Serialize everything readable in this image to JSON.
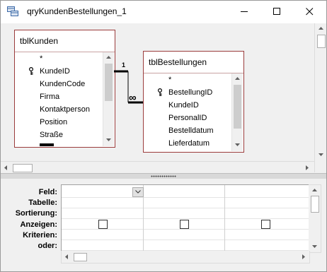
{
  "window": {
    "title": "qryKundenBestellungen_1",
    "icon": "query-icon",
    "controls": [
      "minimize-icon",
      "maximize-icon",
      "close-icon"
    ]
  },
  "tables": [
    {
      "name": "tblKunden",
      "fields": [
        "*",
        "KundeID",
        "KundenCode",
        "Firma",
        "Kontaktperson",
        "Position",
        "Straße"
      ],
      "key_field": "KundeID"
    },
    {
      "name": "tblBestellungen",
      "fields": [
        "*",
        "BestellungID",
        "KundeID",
        "PersonalID",
        "Bestelldatum",
        "Lieferdatum"
      ],
      "key_field": "BestellungID"
    }
  ],
  "relationship": {
    "one_side_label": "1",
    "many_side_label": "∞"
  },
  "grid": {
    "row_labels": [
      "Feld:",
      "Tabelle:",
      "Sortierung:",
      "Anzeigen:",
      "Kriterien:",
      "oder:"
    ],
    "columns": 3,
    "show_checked": [
      false,
      false,
      false
    ]
  },
  "colors": {
    "table_border": "#9b3c3c",
    "pane_background": "#f0f0f0"
  }
}
